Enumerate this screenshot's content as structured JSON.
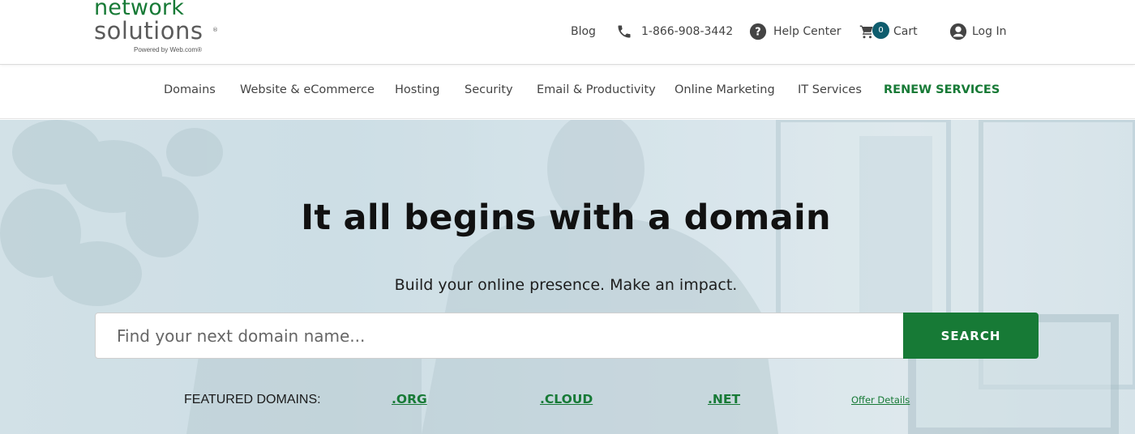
{
  "header": {
    "logo": {
      "line1": "network",
      "line2": "solutions",
      "registered": "®",
      "powered_by": "Powered by Web.com®"
    },
    "links": {
      "blog": "Blog",
      "phone": "1-866-908-3442",
      "help": "Help Center",
      "cart_count": "0",
      "cart": "Cart",
      "login": "Log In"
    },
    "icons": {
      "phone": "phone-icon",
      "help": "question-circle-icon",
      "cart": "cart-icon",
      "login": "user-circle-icon"
    }
  },
  "nav": {
    "items": [
      "Domains",
      "Website & eCommerce",
      "Hosting",
      "Security",
      "Email & Productivity",
      "Online Marketing",
      "IT Services"
    ],
    "renew": "RENEW SERVICES"
  },
  "hero": {
    "title": "It all begins with a domain",
    "subtitle": "Build your online presence. Make an impact.",
    "search": {
      "placeholder": "Find your next domain name...",
      "value": "",
      "button": "SEARCH"
    },
    "featured": {
      "label": "FEATURED DOMAINS:",
      "domains": [
        ".ORG",
        ".CLOUD",
        ".NET"
      ],
      "offer": "Offer Details"
    }
  },
  "colors": {
    "brand_green": "#177a36",
    "badge_teal": "#0f5d6e",
    "hero_bg": "#cfdfe6"
  }
}
